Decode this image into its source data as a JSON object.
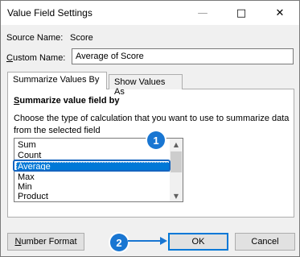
{
  "window": {
    "title": "Value Field Settings",
    "controls": [
      "minimize-icon",
      "maximize-icon",
      "close-icon"
    ]
  },
  "source": {
    "label": "Source Name:",
    "value": "Score"
  },
  "custom_name": {
    "label_mnemonic": "C",
    "label_rest": "ustom Name:",
    "value": "Average of Score"
  },
  "tabs": [
    {
      "label": "Summarize Values By",
      "active": true
    },
    {
      "label": "Show Values As",
      "active": false
    }
  ],
  "panel": {
    "title_mnemonic": "S",
    "title_rest": "ummarize value field by",
    "description": "Choose the type of calculation that you want to use to summarize data from the selected field"
  },
  "list": {
    "items": [
      "Sum",
      "Count",
      "Average",
      "Max",
      "Min",
      "Product"
    ],
    "selected": "Average"
  },
  "buttons": {
    "number_format_mnemonic": "N",
    "number_format_rest": "umber Format",
    "ok": "OK",
    "cancel": "Cancel"
  },
  "annotations": {
    "badge_1": "1",
    "badge_2": "2"
  },
  "colors": {
    "selection": "#0078d7",
    "badge": "#1976d2",
    "ok_border": "#0078d7"
  }
}
